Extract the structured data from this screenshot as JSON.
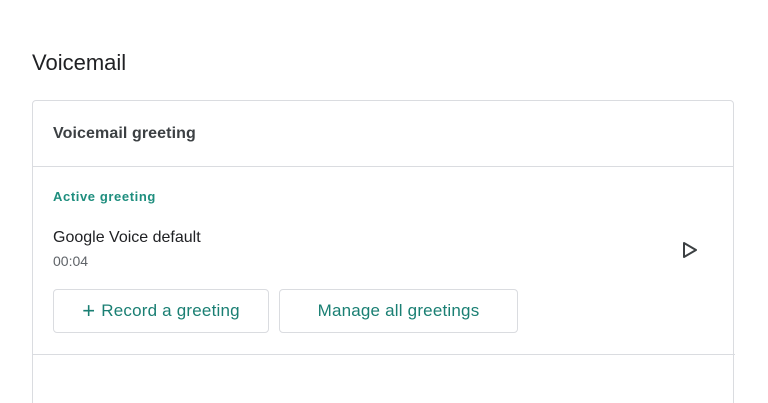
{
  "section": {
    "title": "Voicemail"
  },
  "card": {
    "header_title": "Voicemail greeting",
    "active_label": "Active greeting",
    "greeting": {
      "name": "Google Voice default",
      "duration": "00:04"
    },
    "buttons": {
      "record_label": "Record a greeting",
      "manage_label": "Manage all greetings"
    },
    "icons": {
      "play": "play-icon",
      "plus": "plus-icon"
    }
  },
  "colors": {
    "accent": "#1a7f73",
    "border": "#dadce0",
    "text_primary": "#202124",
    "text_secondary": "#5f6368"
  }
}
